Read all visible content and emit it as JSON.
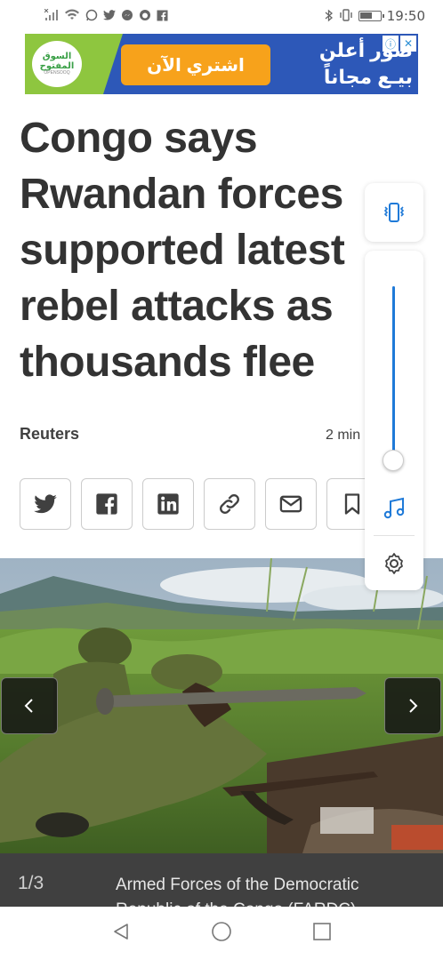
{
  "status_bar": {
    "time": "19:50",
    "icons": [
      "sim-icon",
      "wifi-icon",
      "whatsapp-icon",
      "twitter-icon",
      "messenger-icon",
      "reddit-icon",
      "facebook-icon",
      "bluetooth-icon",
      "vibrate-icon",
      "battery-icon"
    ],
    "battery_level": 0.6
  },
  "ad": {
    "logo_text": "السوق المفتوح",
    "logo_subtext": "OPENSOOQ",
    "cta": "اشتري الآن",
    "headline_line1": "صور أعلن",
    "headline_line2": "بيـع مجاناً",
    "colors": {
      "background": "#2d58b8",
      "accent": "#8ec63f",
      "cta": "#f7a21b"
    }
  },
  "article": {
    "headline": "Congo says Rwandan forces supported latest rebel attacks as thousands flee",
    "byline": "Reuters",
    "read_time": "2 min"
  },
  "share_buttons": [
    "twitter-icon",
    "facebook-icon",
    "linkedin-icon",
    "link-icon",
    "email-icon",
    "bookmark-icon"
  ],
  "volume_panel": {
    "level": 0.05,
    "accent": "#1f7ad8"
  },
  "gallery": {
    "counter": "1/3",
    "caption": "Armed Forces of the Democratic Republic of the Congo (FARDC)"
  },
  "nav_bar": {
    "buttons": [
      "back-icon",
      "home-icon",
      "recents-icon"
    ]
  }
}
